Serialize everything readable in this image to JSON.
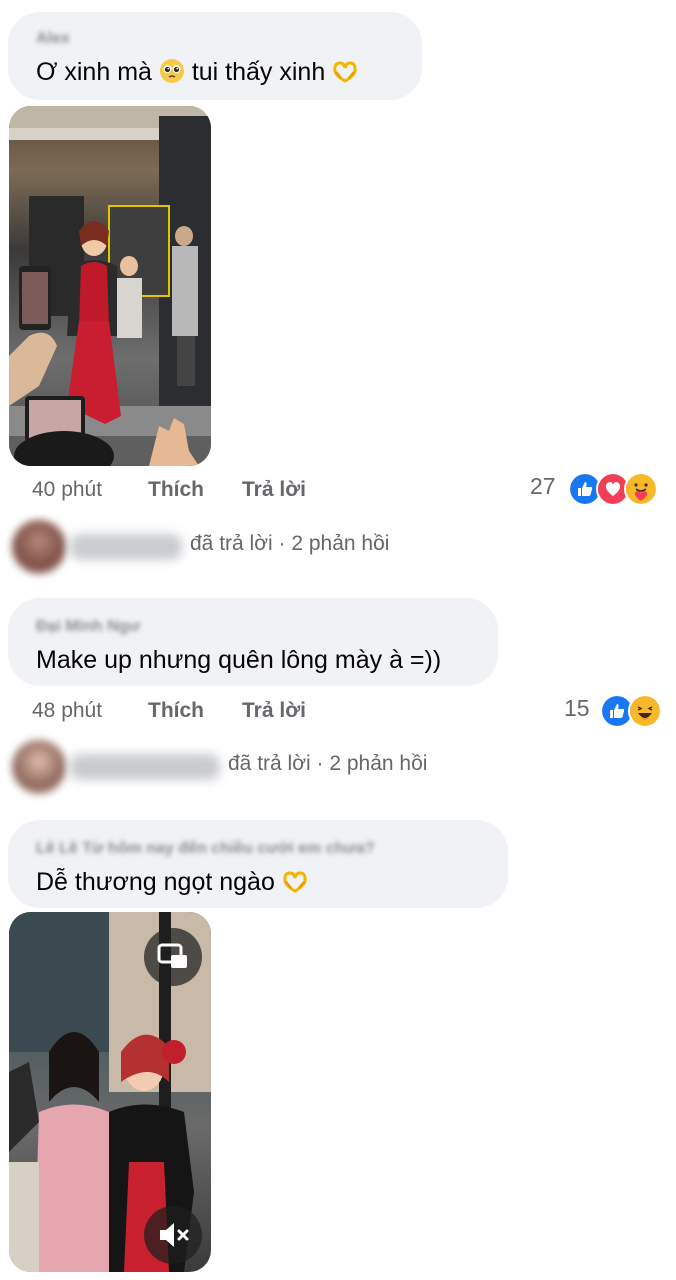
{
  "comments": [
    {
      "author": "Alex",
      "text_before_emoji": "Ơ xinh mà ",
      "text_after_emoji": " tui thấy xinh ",
      "emoji_inline": "pleading-face",
      "emoji_end": "heart-hands",
      "time": "40 phút",
      "like_label": "Thích",
      "reply_label": "Trả lời",
      "reaction_count": "27",
      "reactions": [
        "like",
        "love",
        "care"
      ],
      "replies": {
        "author": "Ngọc Ly Ly",
        "replied_label": "đã trả lời",
        "separator": "·",
        "count_label": "2 phản hồi"
      }
    },
    {
      "author": "Đại Minh Ngư",
      "text": "Make up nhưng quên lông mày à =))",
      "time": "48 phút",
      "like_label": "Thích",
      "reply_label": "Trả lời",
      "reaction_count": "15",
      "reactions": [
        "like",
        "haha"
      ],
      "replies": {
        "author": "Huong Nguyen",
        "replied_label": "đã trả lời",
        "separator": "·",
        "count_label": "2 phản hồi"
      }
    },
    {
      "author": "Lê Lê Từ hôm nay đến chiều cưới em chưa?",
      "text": "Dễ thương ngọt ngào ",
      "emoji_end": "heart-hands"
    }
  ],
  "colors": {
    "bubble": "#f0f2f5",
    "meta_text": "#65676b",
    "like_blue": "#1877f2",
    "love_red": "#f33e58",
    "emoji_yellow": "#f7b928"
  },
  "icons": {
    "pip": "picture-in-picture-icon",
    "mute": "speaker-muted-icon"
  }
}
